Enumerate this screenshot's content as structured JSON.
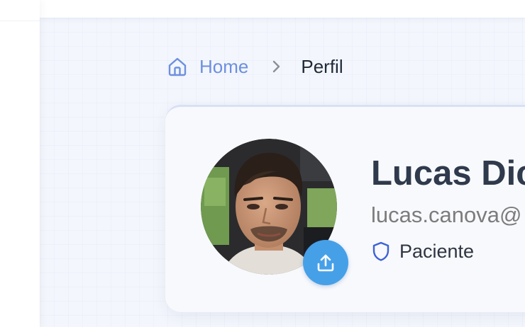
{
  "breadcrumb": {
    "home_label": "Home",
    "current_label": "Perfil"
  },
  "profile": {
    "name": "Lucas Dic",
    "email": "lucas.canova@",
    "role": "Paciente"
  },
  "icons": {
    "home": "home-icon",
    "separator": "chevron-right-icon",
    "upload": "upload-icon",
    "role": "shield-icon"
  },
  "colors": {
    "accent_blue": "#6d8fe0",
    "upload_button": "#46a0e8",
    "shield": "#3d62d6",
    "name_text": "#2f3a4c",
    "email_text": "#7c7c7c"
  }
}
